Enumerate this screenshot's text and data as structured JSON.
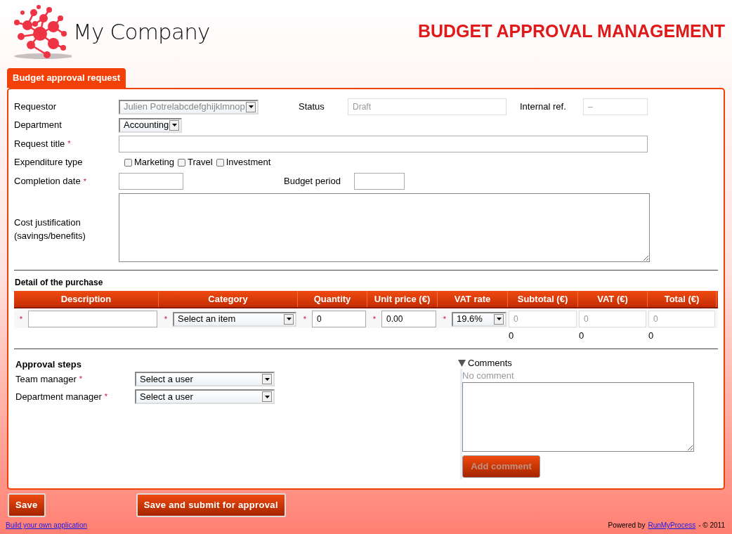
{
  "header": {
    "company": "My Company",
    "title": "BUDGET APPROVAL MANAGEMENT"
  },
  "tabs": [
    {
      "label": "Budget approval request",
      "selected": true
    }
  ],
  "form": {
    "requestor": {
      "label": "Requestor",
      "value": "Julien Potrelabcdefghijklmnop",
      "disabled": true
    },
    "status": {
      "label": "Status",
      "value": "Draft"
    },
    "internal_ref": {
      "label": "Internal ref.",
      "value": "–"
    },
    "department": {
      "label": "Department",
      "value": "Accounting"
    },
    "request_title": {
      "label": "Request title",
      "required_mark": "*"
    },
    "expenditure_type": {
      "label": "Expenditure type",
      "options": [
        {
          "label": "Marketing",
          "checked": false
        },
        {
          "label": "Travel",
          "checked": false
        },
        {
          "label": "Investment",
          "checked": false
        }
      ]
    },
    "completion_date": {
      "label": "Completion date",
      "required_mark": "*"
    },
    "budget_period": {
      "label": "Budget period"
    },
    "cost_justification": {
      "label": "Cost justification (savings/benefits)"
    }
  },
  "purchase": {
    "title": "Detail of the purchase",
    "columns": [
      "Description",
      "Category",
      "Quantity",
      "Unit price (€)",
      "VAT rate",
      "Subtotal (€)",
      "VAT (€)",
      "Total (€)"
    ],
    "rows": [
      {
        "cells": [
          {
            "kind": "input",
            "required_mark": "*"
          },
          {
            "kind": "select",
            "value": "Select an item",
            "required_mark": "*"
          },
          {
            "kind": "input",
            "value": "0",
            "required_mark": "*"
          },
          {
            "kind": "input",
            "value": "0.00",
            "required_mark": "*"
          },
          {
            "kind": "select",
            "value": "19.6%",
            "required_mark": "*"
          },
          {
            "kind": "readonly",
            "value": "0"
          },
          {
            "kind": "readonly",
            "value": "0"
          },
          {
            "kind": "readonly",
            "value": "0"
          }
        ]
      }
    ],
    "totals": [
      "0",
      "0",
      "0"
    ]
  },
  "approval": {
    "title": "Approval steps",
    "steps": [
      {
        "label": "Team manager",
        "required_mark": "*",
        "value": "Select a user"
      },
      {
        "label": "Department manager",
        "required_mark": "*",
        "value": "Select a user"
      }
    ]
  },
  "comments": {
    "label": "Comments",
    "expanded": true,
    "empty_text": "No comment",
    "button": {
      "label": "Add comment",
      "disabled": true
    }
  },
  "buttons": [
    "Save",
    "Save and submit for approval"
  ],
  "footer": {
    "link": "Build your own application",
    "powered_prefix": "Powered by",
    "powered_link": "RunMyProcess",
    "powered_suffix": "- © 2011"
  }
}
